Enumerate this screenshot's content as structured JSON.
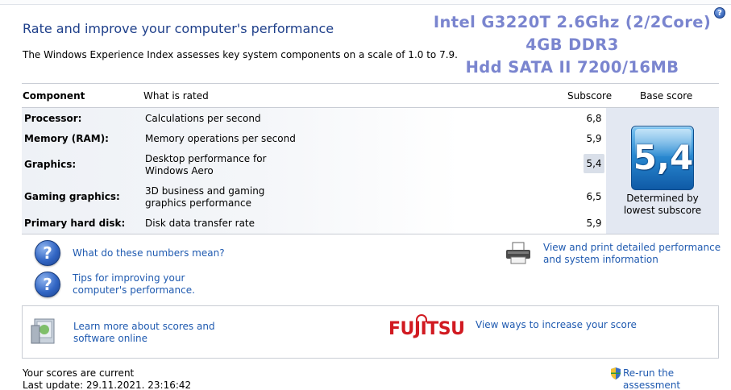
{
  "page": {
    "title": "Rate and improve your computer's performance",
    "subtitle": "The Windows Experience Index assesses key system components on a scale of 1.0 to 7.9."
  },
  "overlay": {
    "line1": "Intel G3220T 2.6Ghz (2/2Core)",
    "line2": "4GB DDR3",
    "line3": "Hdd SATA II 7200/16MB"
  },
  "table": {
    "headers": {
      "component": "Component",
      "rated": "What is rated",
      "subscore": "Subscore",
      "base": "Base score"
    },
    "rows": [
      {
        "component": "Processor:",
        "rated": "Calculations per second",
        "subscore": "6,8"
      },
      {
        "component": "Memory (RAM):",
        "rated": "Memory operations per second",
        "subscore": "5,9"
      },
      {
        "component": "Graphics:",
        "rated": "Desktop performance for Windows Aero",
        "subscore": "5,4"
      },
      {
        "component": "Gaming graphics:",
        "rated": "3D business and gaming graphics performance",
        "subscore": "6,5"
      },
      {
        "component": "Primary hard disk:",
        "rated": "Disk data transfer rate",
        "subscore": "5,9"
      }
    ],
    "base_score": "5,4",
    "base_caption": "Determined by lowest subscore"
  },
  "links": {
    "numbers_meaning": "What do these numbers mean?",
    "tips": "Tips for improving your computer's performance.",
    "view_print": "View and print detailed performance and system information",
    "learn_more": "Learn more about scores and software online",
    "view_ways": "View ways to increase your score",
    "rerun": "Re-run the assessment"
  },
  "logo": {
    "text": "FUJITSU"
  },
  "status": {
    "current": "Your scores are current",
    "last_update": "Last update: 29.11.2021. 23:16:42"
  },
  "icons": {
    "help": "help-icon",
    "question": "question-icon",
    "printer": "printer-icon",
    "software": "software-box-icon",
    "shield": "uac-shield-icon"
  },
  "colors": {
    "title_blue": "#1e3f8a",
    "link_blue": "#1f5ab0",
    "overlay_purple": "#7a85cf",
    "fujitsu_red": "#d11a21",
    "badge_blue": "#2a8ad2"
  }
}
